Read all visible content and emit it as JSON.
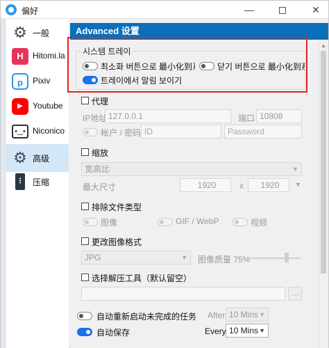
{
  "window": {
    "title": "偏好",
    "minimize": "—",
    "maximize": "",
    "close": "✕"
  },
  "sidebar": {
    "items": [
      {
        "label": "一般",
        "icon": "gear-icon",
        "glyph": "⚙"
      },
      {
        "label": "Hitomi.la",
        "icon": "hitomi-icon",
        "glyph": "H"
      },
      {
        "label": "Pixiv",
        "icon": "pixiv-icon",
        "glyph": "p"
      },
      {
        "label": "Youtube",
        "icon": "youtube-icon",
        "glyph": "▶"
      },
      {
        "label": "Niconico",
        "icon": "niconico-icon",
        "glyph": "•‿•"
      },
      {
        "label": "高级",
        "icon": "gears-icon",
        "glyph": "⚙"
      },
      {
        "label": "压缩",
        "icon": "zip-icon",
        "glyph": "⋮"
      }
    ],
    "active_index": 5
  },
  "panel": {
    "header": "Advanced 设置",
    "tray": {
      "title": "시스템 트레이",
      "minimize_to_tray": "최소화 버튼으로 最小化到系统",
      "close_to_tray": "닫기 버튼으로 最小化到系统",
      "show_notifications": "트레이에서 알림 보이기"
    },
    "proxy": {
      "title": "代理",
      "ip_label": "IP地址",
      "ip_value": "127.0.0.1",
      "port_label": "端口",
      "port_value": "10808",
      "auth_label": "帐户 / 密码",
      "id_placeholder": "ID",
      "password_placeholder": "Password"
    },
    "resize": {
      "title": "缩放",
      "mode": "宽高比",
      "max_size_label": "最大尺寸",
      "width": "1920",
      "x": "x",
      "height": "1920"
    },
    "exclude": {
      "title": "排除文件类型",
      "image": "图像",
      "gif": "GIF / WebP",
      "video": "视频"
    },
    "format": {
      "title": "更改图像格式",
      "format_value": "JPG",
      "quality_label": "图像质量 75%",
      "quality": 75
    },
    "extract": {
      "title": "选择解压工具（默认留空）",
      "browse": "..."
    },
    "auto_restart": {
      "label": "自动重新启动未完成的任务",
      "after_label": "After",
      "after_value": "10 Mins"
    },
    "auto_save": {
      "label": "自动保存",
      "every_label": "Every",
      "every_value": "10 Mins"
    }
  }
}
